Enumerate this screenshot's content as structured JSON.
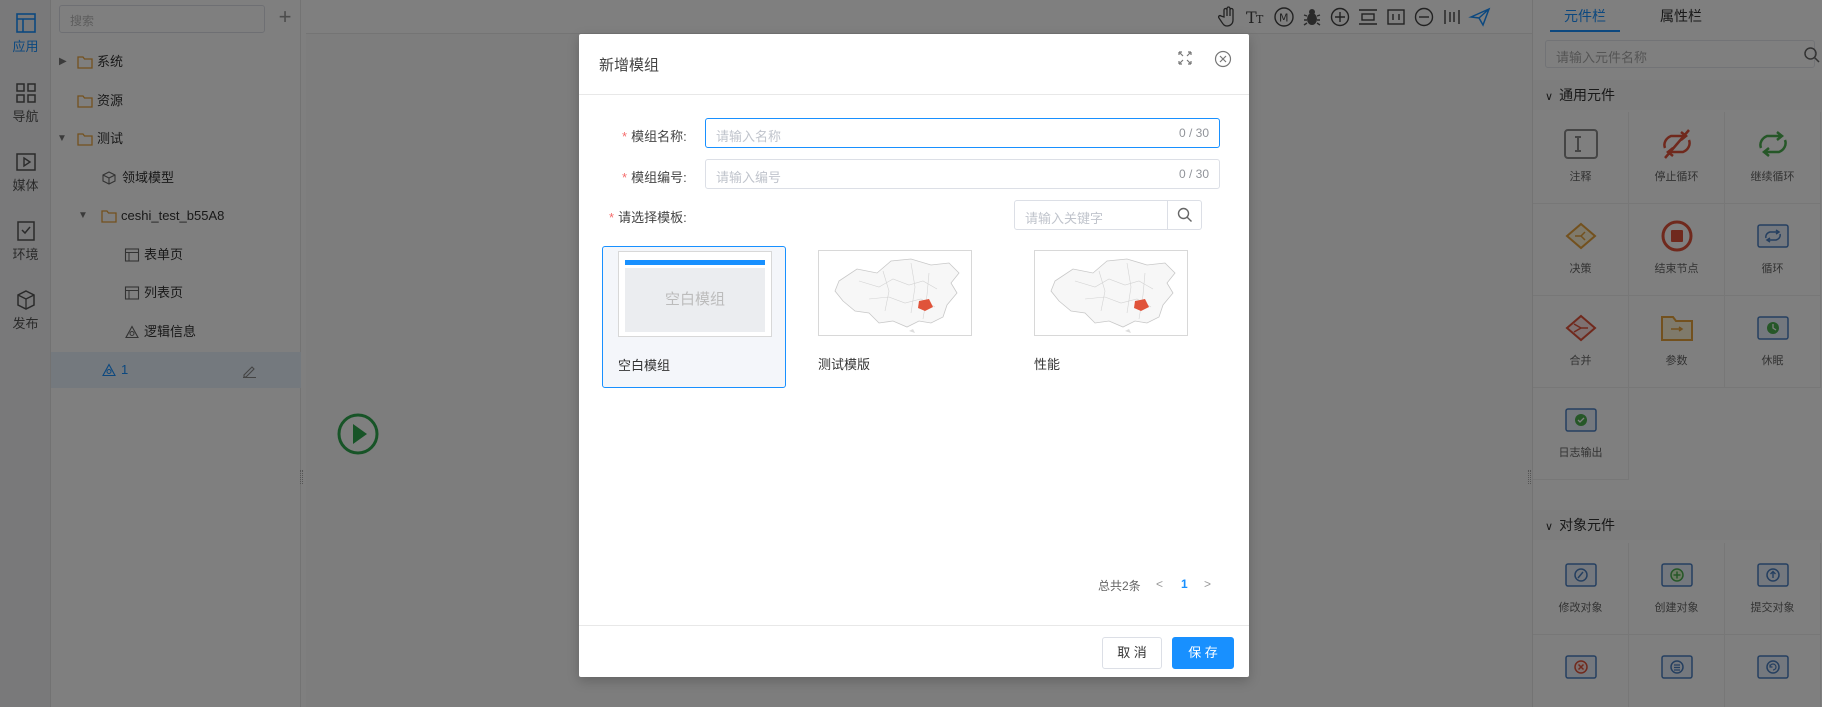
{
  "nav": {
    "items": [
      {
        "label": "应用",
        "icon": "app-layout-icon"
      },
      {
        "label": "导航",
        "icon": "grid-icon"
      },
      {
        "label": "媒体",
        "icon": "media-icon"
      },
      {
        "label": "环境",
        "icon": "environment-icon"
      },
      {
        "label": "发布",
        "icon": "publish-cube-icon"
      }
    ]
  },
  "tree": {
    "search_placeholder": "搜索",
    "add_icon": "+",
    "nodes": [
      {
        "label": "系统"
      },
      {
        "label": "资源"
      },
      {
        "label": "测试"
      },
      {
        "label": "领域模型"
      },
      {
        "label": "ceshi_test_b55A8"
      },
      {
        "label": "表单页"
      },
      {
        "label": "列表页"
      },
      {
        "label": "逻辑信息"
      },
      {
        "label": "1"
      }
    ]
  },
  "right_panel": {
    "tabs": [
      {
        "label": "元件栏"
      },
      {
        "label": "属性栏"
      }
    ],
    "search_placeholder": "请输入元件名称",
    "sections": [
      {
        "title": "通用元件",
        "items": [
          {
            "label": "注释"
          },
          {
            "label": "停止循环"
          },
          {
            "label": "继续循环"
          },
          {
            "label": "决策"
          },
          {
            "label": "结束节点"
          },
          {
            "label": "循环"
          },
          {
            "label": "合并"
          },
          {
            "label": "参数"
          },
          {
            "label": "休眠"
          },
          {
            "label": "日志输出"
          }
        ]
      },
      {
        "title": "对象元件",
        "items": [
          {
            "label": "修改对象"
          },
          {
            "label": "创建对象"
          },
          {
            "label": "提交对象"
          }
        ]
      }
    ]
  },
  "dialog": {
    "title": "新增模组",
    "fields": {
      "name": {
        "label": "模组名称:",
        "placeholder": "请输入名称",
        "count": "0 / 30"
      },
      "code": {
        "label": "模组编号:",
        "placeholder": "请输入编号",
        "count": "0 / 30"
      },
      "template": {
        "label": "请选择模板:",
        "keyword_placeholder": "请输入关键字"
      }
    },
    "required_mark": "*",
    "templates": [
      {
        "name": "空白模组",
        "thumb_text": "空白模组",
        "selected": true
      },
      {
        "name": "测试模版",
        "selected": false
      },
      {
        "name": "性能",
        "selected": false
      }
    ],
    "pagination": {
      "total": "总共2条",
      "current": "1"
    },
    "buttons": {
      "cancel": "取 消",
      "save": "保 存"
    }
  },
  "colors": {
    "accent": "#1890ff",
    "required": "#f56c6c",
    "map_highlight": "#e0533a"
  }
}
